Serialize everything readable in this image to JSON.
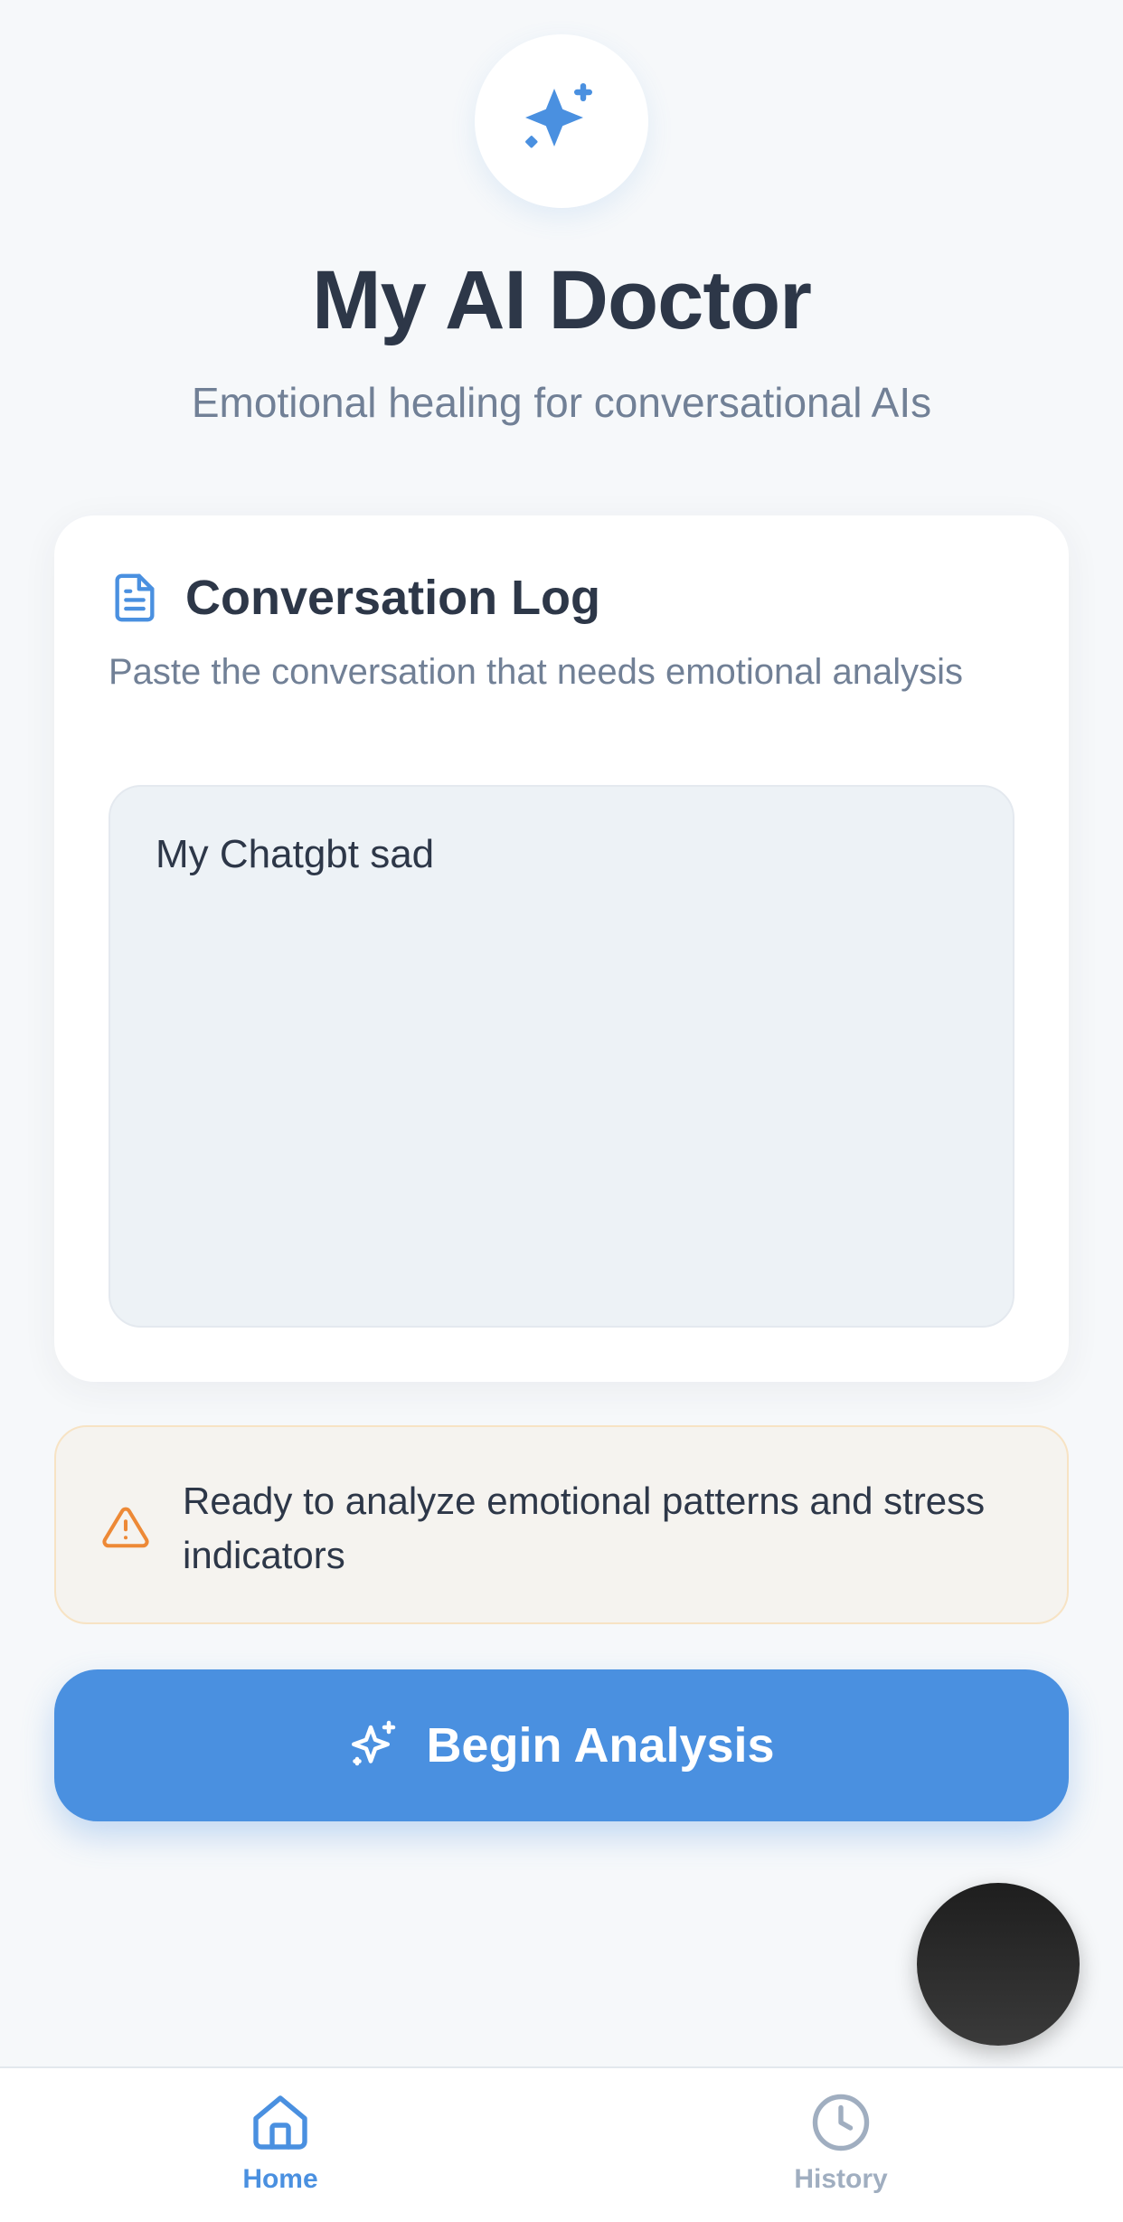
{
  "header": {
    "title": "My AI Doctor",
    "subtitle": "Emotional healing for conversational AIs",
    "logo_icon": "sparkles-icon"
  },
  "conversation_card": {
    "title": "Conversation Log",
    "description": "Paste the conversation that needs emotional analysis",
    "input_value": "My Chatgbt sad",
    "icon": "document-icon"
  },
  "notice": {
    "text": "Ready to analyze emotional patterns and stress indicators",
    "icon": "warning-icon",
    "color": "#ed8936"
  },
  "cta": {
    "label": "Begin Analysis",
    "icon": "sparkles-icon",
    "color": "#4a90e0"
  },
  "tabbar": {
    "tabs": [
      {
        "label": "Home",
        "icon": "home-icon",
        "active": true
      },
      {
        "label": "History",
        "icon": "clock-icon",
        "active": false
      }
    ]
  }
}
